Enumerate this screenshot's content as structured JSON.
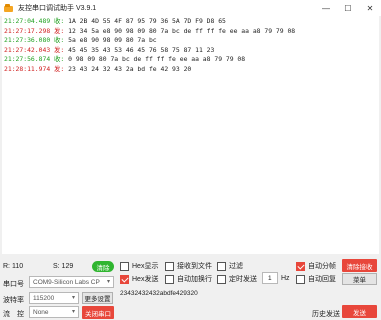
{
  "window": {
    "title": "友控串口调试助手 V3.9.1",
    "minimize": "—",
    "maximize": "☐",
    "close": "✕"
  },
  "log": [
    {
      "ts": "21:27:04.489",
      "dir": "收:",
      "data": "1A 2B 4D 55 4F 87 95 79 36 5A 7D F9 D8 65",
      "color": "green"
    },
    {
      "ts": "21:27:17.298",
      "dir": "发:",
      "data": "12 34 5a e8 90 98 09 80 7a bc de ff ff fe ee aa a8 79 79 08",
      "color": "red"
    },
    {
      "ts": "21:27:36.080",
      "dir": "收:",
      "data": "5a e8 90 98 09 80 7a bc",
      "color": "green"
    },
    {
      "ts": "21:27:42.043",
      "dir": "发:",
      "data": "45 45 35 43 53 46 45 76 58 75 87 11 23",
      "color": "red"
    },
    {
      "ts": "21:27:56.874",
      "dir": "收:",
      "data": "0 98 09 80 7a bc de ff ff fe ee aa a8 79 79 08",
      "color": "green"
    },
    {
      "ts": "21:28:11.974",
      "dir": "发:",
      "data": "23 43 24 32 43 2a bd fe 42 93 20",
      "color": "red"
    }
  ],
  "status": {
    "r_label": "R: 110",
    "s_label": "S: 129",
    "clear_count": "清除"
  },
  "serial": {
    "port_label": "串口号",
    "port_value": "COM9-Silicon Labs CP",
    "baud_label": "波特率",
    "baud_value": "115200",
    "more_settings": "更多设置",
    "flow_label": "流　控",
    "flow_value": "None",
    "close_port": "关闭串口"
  },
  "options": {
    "hex_display": "Hex显示",
    "recv_to_file": "接收到文件",
    "filter": "过滤",
    "auto_split": "自动分帧",
    "clear_recv": "清除接收",
    "hex_send": "Hex发送",
    "auto_newline": "自动加换行",
    "timed_send": "定时发送",
    "interval": "1",
    "unit": "Hz",
    "auto_reply": "自动回复",
    "menu": "菜单"
  },
  "send": {
    "content": "23432432432abdfe429320",
    "history": "历史发送",
    "send_button": "发送"
  },
  "colors": {
    "accent_red": "#e8473b",
    "ts_green": "#21a121",
    "ts_red": "#d02020"
  }
}
